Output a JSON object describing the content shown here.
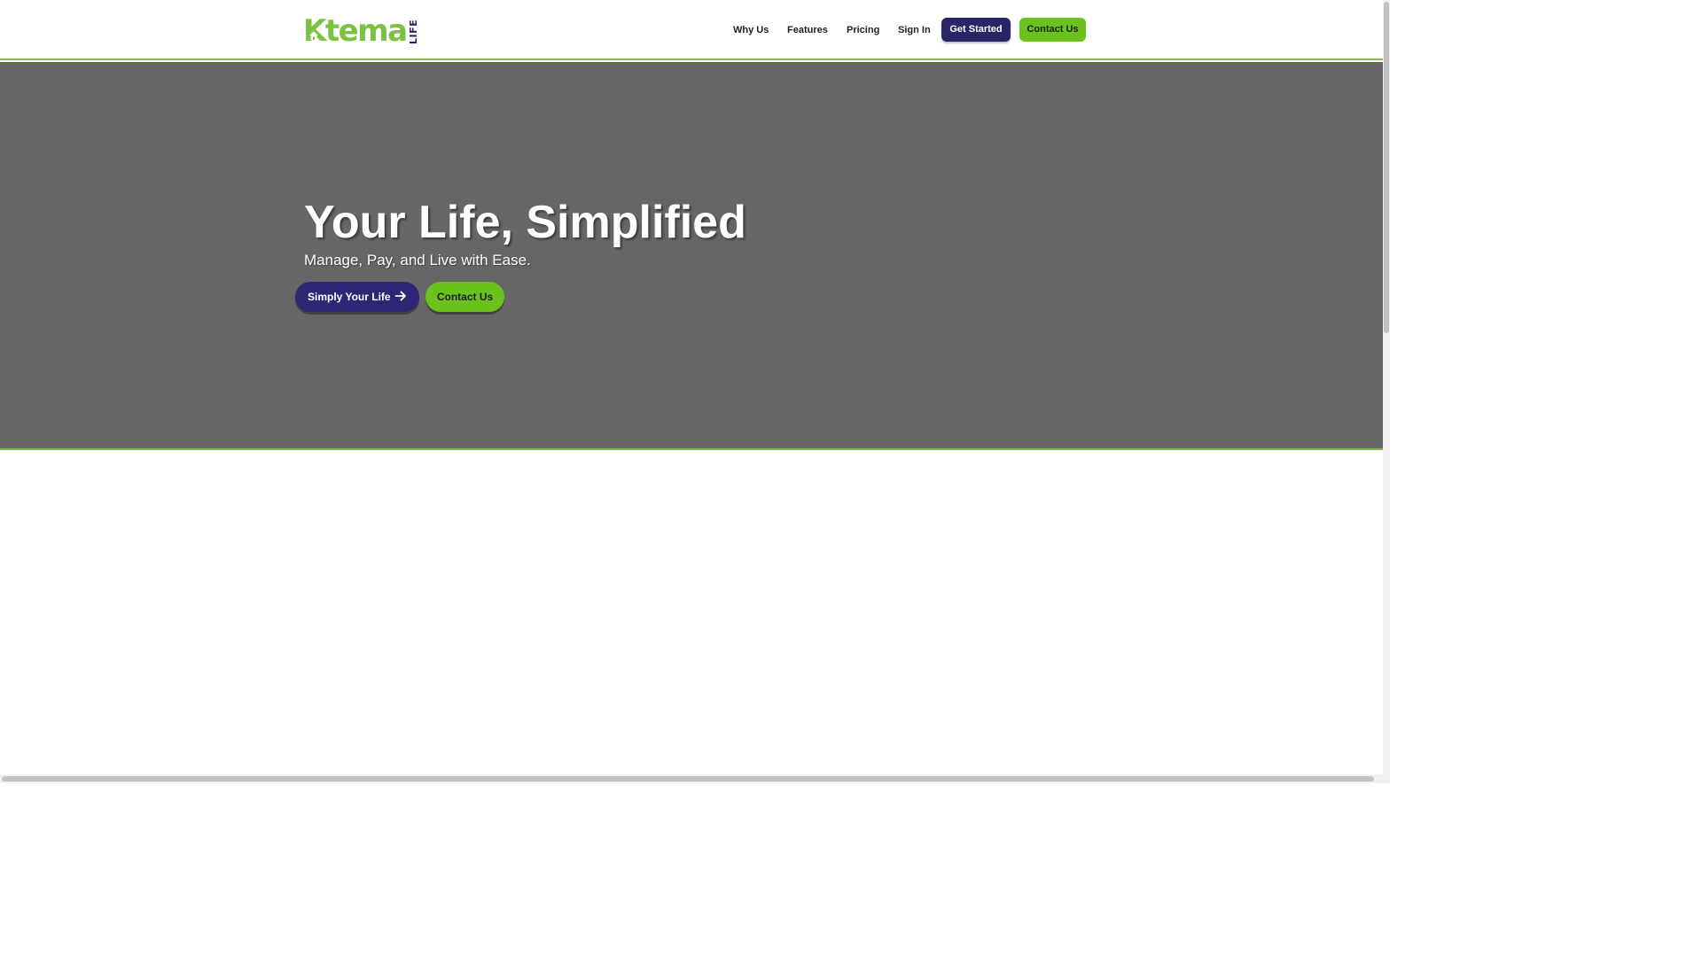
{
  "brand": {
    "name": "Ktema",
    "suffix": "LIFE",
    "colors": {
      "green": "#7cc242",
      "dark": "#2a2565",
      "hero_bg": "#666666"
    }
  },
  "nav": {
    "links": [
      "Why Us",
      "Features",
      "Pricing",
      "Sign In"
    ],
    "get_started": "Get Started",
    "contact": "Contact Us"
  },
  "hero": {
    "title": "Your Life, Simplified",
    "subtitle": "Manage, Pay, and Live with Ease.",
    "primary_cta": "Simply Your Life",
    "primary_cta_icon": "arrow-right-icon",
    "secondary_cta": "Contact Us"
  }
}
